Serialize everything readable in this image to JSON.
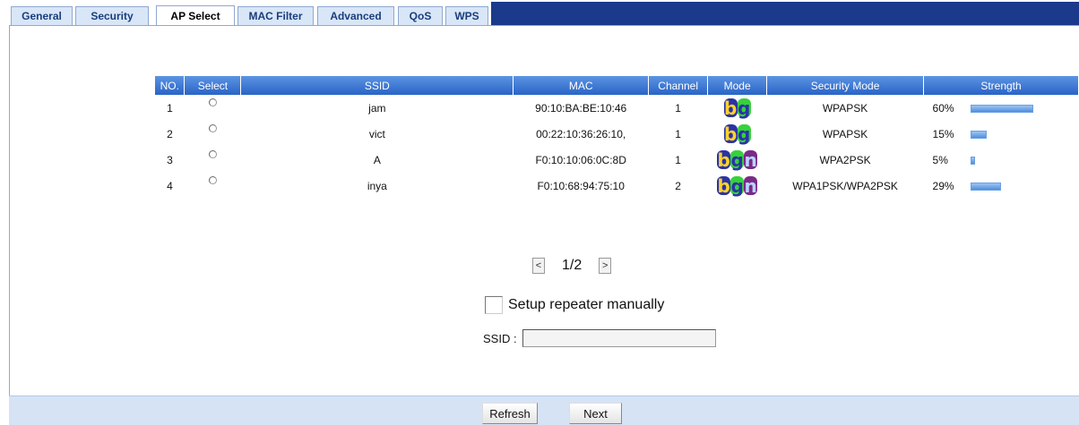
{
  "tabs": [
    {
      "label": "General",
      "active": false
    },
    {
      "label": "Security",
      "active": false
    },
    {
      "label": "AP Select",
      "active": true
    },
    {
      "label": "MAC Filter",
      "active": false
    },
    {
      "label": "Advanced",
      "active": false
    },
    {
      "label": "QoS",
      "active": false
    },
    {
      "label": "WPS",
      "active": false
    }
  ],
  "table": {
    "columns": [
      "NO.",
      "Select",
      "SSID",
      "MAC",
      "Channel",
      "Mode",
      "Security Mode",
      "Strength"
    ],
    "rows": [
      {
        "no": "1",
        "ssid": "jam",
        "mac": "90:10:BA:BE:10:46",
        "channel": "1",
        "mode": [
          "b",
          "g"
        ],
        "security": "WPAPSK",
        "strength": "60%",
        "strength_value": 60
      },
      {
        "no": "2",
        "ssid": "vict",
        "mac": "00:22:10:36:26:10,",
        "channel": "1",
        "mode": [
          "b",
          "g"
        ],
        "security": "WPAPSK",
        "strength": "15%",
        "strength_value": 15
      },
      {
        "no": "3",
        "ssid": "A",
        "mac": "F0:10:10:06:0C:8D",
        "channel": "1",
        "mode": [
          "b",
          "g",
          "n"
        ],
        "security": "WPA2PSK",
        "strength": "5%",
        "strength_value": 5
      },
      {
        "no": "4",
        "ssid": "inya",
        "mac": "F0:10:68:94:75:10",
        "channel": "2",
        "mode": [
          "b",
          "g",
          "n"
        ],
        "security": "WPA1PSK/WPA2PSK",
        "strength": "29%",
        "strength_value": 29
      }
    ]
  },
  "pager": {
    "prev": "<",
    "page": "1/2",
    "next": ">"
  },
  "manual": {
    "label": "Setup repeater manually",
    "checked": false
  },
  "ssid": {
    "label": "SSID :",
    "value": ""
  },
  "buttons": {
    "refresh": "Refresh",
    "next": "Next"
  },
  "colors": {
    "header": "#2f6fd0",
    "tab_strip": "#1b3a8c",
    "footer": "#d6e3f5",
    "strength_bar": "#4f8fe0"
  }
}
